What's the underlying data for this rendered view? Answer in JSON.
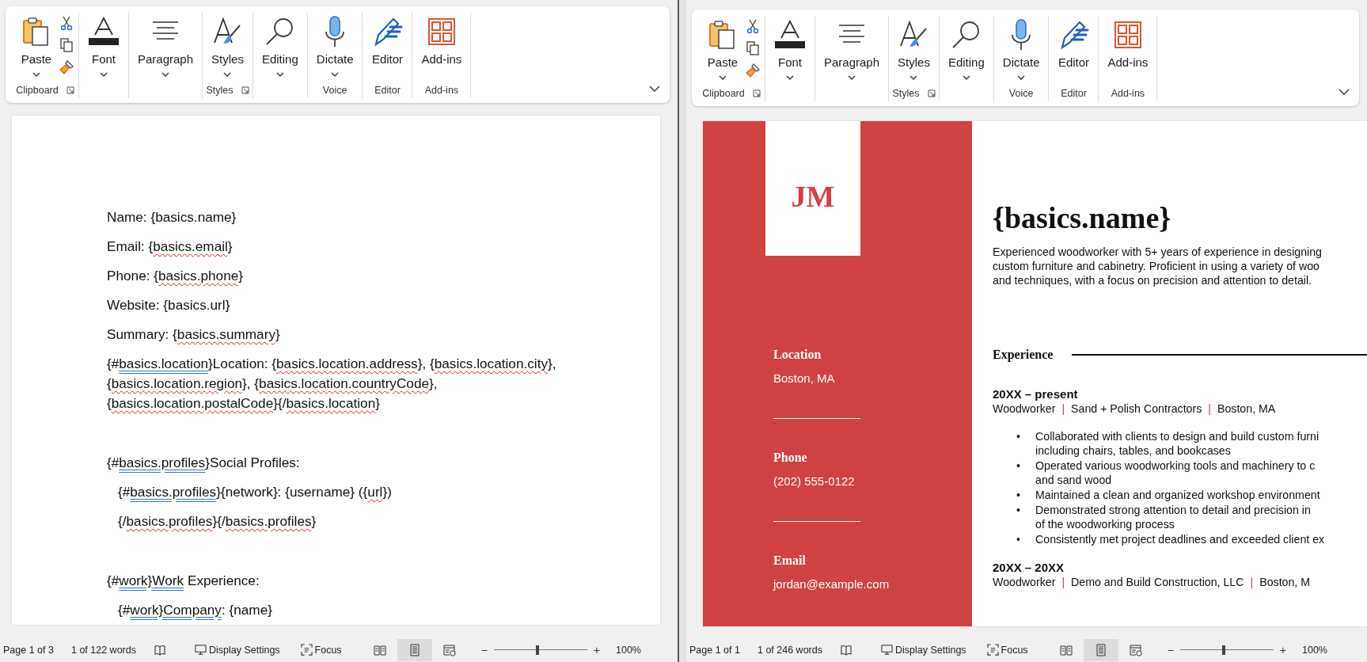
{
  "windows": [
    {
      "ribbon": {
        "groups": [
          {
            "label": "Clipboard",
            "launcher": true,
            "buttons": [
              {
                "kind": "paste",
                "label": "Paste",
                "caret": true
              },
              {
                "kind": "cut"
              },
              {
                "kind": "copy"
              },
              {
                "kind": "painter"
              }
            ]
          },
          {
            "buttons": [
              {
                "kind": "font",
                "label": "Font",
                "caret": true
              }
            ]
          },
          {
            "buttons": [
              {
                "kind": "paragraph",
                "label": "Paragraph",
                "caret": true
              }
            ]
          },
          {
            "label": "Styles",
            "launcher": true,
            "buttons": [
              {
                "kind": "styles",
                "label": "Styles",
                "caret": true
              }
            ]
          },
          {
            "buttons": [
              {
                "kind": "editing",
                "label": "Editing",
                "caret": true
              }
            ]
          },
          {
            "label": "Voice",
            "buttons": [
              {
                "kind": "dictate",
                "label": "Dictate",
                "caret": true
              }
            ]
          },
          {
            "label": "Editor",
            "buttons": [
              {
                "kind": "editor",
                "label": "Editor"
              }
            ]
          },
          {
            "label": "Add-ins",
            "buttons": [
              {
                "kind": "addins",
                "label": "Add-ins"
              }
            ]
          }
        ]
      },
      "document": {
        "kind": "template",
        "blocks": [
          {
            "paragraphs": [
              {
                "indented": false,
                "parts": [
                  {
                    "kind": "plain",
                    "text": "Name: {basics.name}"
                  }
                ]
              },
              {
                "indented": false,
                "parts": [
                  {
                    "kind": "plain",
                    "text": "Email: {"
                  },
                  {
                    "kind": "spelling",
                    "text": "basics.email"
                  },
                  {
                    "kind": "plain",
                    "text": "}"
                  }
                ]
              },
              {
                "indented": false,
                "parts": [
                  {
                    "kind": "plain",
                    "text": "Phone: {"
                  },
                  {
                    "kind": "spelling",
                    "text": "basics.phone"
                  },
                  {
                    "kind": "plain",
                    "text": "}"
                  }
                ]
              },
              {
                "indented": false,
                "parts": [
                  {
                    "kind": "plain",
                    "text": "Website: {basics.url}"
                  }
                ]
              },
              {
                "indented": false,
                "parts": [
                  {
                    "kind": "plain",
                    "text": "Summary: {"
                  },
                  {
                    "kind": "spelling",
                    "text": "basics.summary"
                  },
                  {
                    "kind": "plain",
                    "text": "}"
                  }
                ]
              },
              {
                "indented": false,
                "parts": [
                  {
                    "kind": "plain",
                    "text": "{#"
                  },
                  {
                    "kind": "grammar",
                    "text": "basics.location"
                  },
                  {
                    "kind": "plain",
                    "text": "}Location: {"
                  },
                  {
                    "kind": "spelling",
                    "text": "basics.location.address"
                  },
                  {
                    "kind": "plain",
                    "text": "}, {"
                  },
                  {
                    "kind": "spelling",
                    "text": "basics.location.city"
                  },
                  {
                    "kind": "plain",
                    "text": "}, {"
                  },
                  {
                    "kind": "spelling",
                    "text": "basics.location.region"
                  },
                  {
                    "kind": "plain",
                    "text": "}, {"
                  },
                  {
                    "kind": "spelling",
                    "text": "basics.location.countryCode"
                  },
                  {
                    "kind": "plain",
                    "text": "}, {"
                  },
                  {
                    "kind": "spelling",
                    "text": "basics.location.postalCode"
                  },
                  {
                    "kind": "plain",
                    "text": "}{/"
                  },
                  {
                    "kind": "spelling",
                    "text": "basics.location"
                  },
                  {
                    "kind": "plain",
                    "text": "}"
                  }
                ]
              }
            ]
          },
          {
            "paragraphs": [
              {
                "indented": false,
                "parts": [
                  {
                    "kind": "plain",
                    "text": "{#"
                  },
                  {
                    "kind": "grammar",
                    "text": "basics.profiles"
                  },
                  {
                    "kind": "plain",
                    "text": "}Social Profiles:"
                  }
                ]
              },
              {
                "indented": true,
                "parts": [
                  {
                    "kind": "plain",
                    "text": "{#"
                  },
                  {
                    "kind": "grammar",
                    "text": "basics.profiles"
                  },
                  {
                    "kind": "plain",
                    "text": "}{network}: {username} ({"
                  },
                  {
                    "kind": "spelling",
                    "text": "url"
                  },
                  {
                    "kind": "plain",
                    "text": "})"
                  }
                ]
              },
              {
                "indented": true,
                "parts": [
                  {
                    "kind": "plain",
                    "text": "{/"
                  },
                  {
                    "kind": "spelling",
                    "text": "basics.profiles"
                  },
                  {
                    "kind": "plain",
                    "text": "}{/"
                  },
                  {
                    "kind": "spelling",
                    "text": "basics.profiles"
                  },
                  {
                    "kind": "plain",
                    "text": "}"
                  }
                ]
              }
            ]
          },
          {
            "paragraphs": [
              {
                "indented": false,
                "parts": [
                  {
                    "kind": "plain",
                    "text": "{#"
                  },
                  {
                    "kind": "grammar",
                    "text": "work}Work"
                  },
                  {
                    "kind": "plain",
                    "text": " Experience:"
                  }
                ]
              },
              {
                "indented": true,
                "parts": [
                  {
                    "kind": "plain",
                    "text": "{#"
                  },
                  {
                    "kind": "grammar",
                    "text": "work}Company"
                  },
                  {
                    "kind": "plain",
                    "text": ": {name}"
                  }
                ]
              }
            ]
          }
        ]
      },
      "status_bar": {
        "page": "Page 1 of 3",
        "words": "1 of 122 words",
        "display_settings": "Display Settings",
        "focus": "Focus",
        "views": [
          {
            "kind": "read",
            "selected": false
          },
          {
            "kind": "print",
            "selected": true
          },
          {
            "kind": "web",
            "selected": false
          }
        ],
        "zoom_out": "−",
        "zoom_in": "+",
        "zoom": {
          "level": 0.47
        },
        "zoom_reading": "100%"
      }
    },
    {
      "ribbon": {
        "groups": [
          {
            "label": "Clipboard",
            "launcher": true,
            "buttons": [
              {
                "kind": "paste",
                "label": "Paste",
                "caret": true
              },
              {
                "kind": "cut"
              },
              {
                "kind": "copy"
              },
              {
                "kind": "painter"
              }
            ]
          },
          {
            "buttons": [
              {
                "kind": "font",
                "label": "Font",
                "caret": true
              }
            ]
          },
          {
            "buttons": [
              {
                "kind": "paragraph",
                "label": "Paragraph",
                "caret": true
              }
            ]
          },
          {
            "label": "Styles",
            "launcher": true,
            "buttons": [
              {
                "kind": "styles",
                "label": "Styles",
                "caret": true
              }
            ]
          },
          {
            "buttons": [
              {
                "kind": "editing",
                "label": "Editing",
                "caret": true
              }
            ]
          },
          {
            "label": "Voice",
            "buttons": [
              {
                "kind": "dictate",
                "label": "Dictate",
                "caret": true
              }
            ]
          },
          {
            "label": "Editor",
            "buttons": [
              {
                "kind": "editor",
                "label": "Editor"
              }
            ]
          },
          {
            "label": "Add-ins",
            "buttons": [
              {
                "kind": "addins",
                "label": "Add-ins"
              }
            ]
          }
        ]
      },
      "document": {
        "kind": "resume",
        "monogram": "JM",
        "contacts": [
          {
            "label": "Location",
            "value": "Boston, MA"
          },
          {
            "label": "Phone",
            "value": "(202) 555-0122"
          },
          {
            "label": "Email",
            "value": "jordan@example.com"
          }
        ],
        "name": "{basics.name}",
        "summary_lines": [
          "Experienced woodworker with 5+ years of experience in designing",
          "custom furniture and cabinetry. Proficient in using a variety of woo",
          "and techniques, with a focus on precision and attention to detail."
        ],
        "section_title": "Experience",
        "jobs": [
          {
            "dates": "20XX – present",
            "meta": [
              {
                "kind": "text",
                "text": "Woodworker"
              },
              {
                "kind": "separator",
                "text": "|"
              },
              {
                "kind": "text",
                "text": "Sand + Polish Contractors"
              },
              {
                "kind": "separator",
                "text": "|"
              },
              {
                "kind": "text",
                "text": "Boston, MA"
              }
            ],
            "bullets": [
              {
                "marker": "•",
                "lines": [
                  "Collaborated with clients to design and build custom furni",
                  "including chairs, tables, and bookcases"
                ]
              },
              {
                "marker": "•",
                "lines": [
                  "Operated various woodworking tools and machinery to c",
                  "and sand wood"
                ]
              },
              {
                "marker": "•",
                "lines": [
                  "Maintained a clean and organized workshop environment"
                ]
              },
              {
                "marker": "•",
                "lines": [
                  "Demonstrated strong attention to detail and precision in",
                  "of the woodworking process"
                ]
              },
              {
                "marker": "•",
                "lines": [
                  "Consistently met project deadlines and exceeded client ex"
                ]
              }
            ]
          },
          {
            "dates": "20XX – 20XX",
            "meta": [
              {
                "kind": "text",
                "text": "Woodworker"
              },
              {
                "kind": "separator",
                "text": "|"
              },
              {
                "kind": "text",
                "text": "Demo and Build Construction, LLC"
              },
              {
                "kind": "separator",
                "text": "|"
              },
              {
                "kind": "text",
                "text": "Boston, M"
              }
            ]
          }
        ]
      },
      "status_bar": {
        "page": "Page 1 of 1",
        "words": "1 of 246 words",
        "display_settings": "Display Settings",
        "focus": "Focus",
        "views": [
          {
            "kind": "read",
            "selected": false
          },
          {
            "kind": "print",
            "selected": true
          },
          {
            "kind": "web",
            "selected": false
          }
        ],
        "zoom_out": "−",
        "zoom_in": "+",
        "zoom": {
          "level": 0.47
        },
        "zoom_reading": "100%"
      }
    }
  ]
}
